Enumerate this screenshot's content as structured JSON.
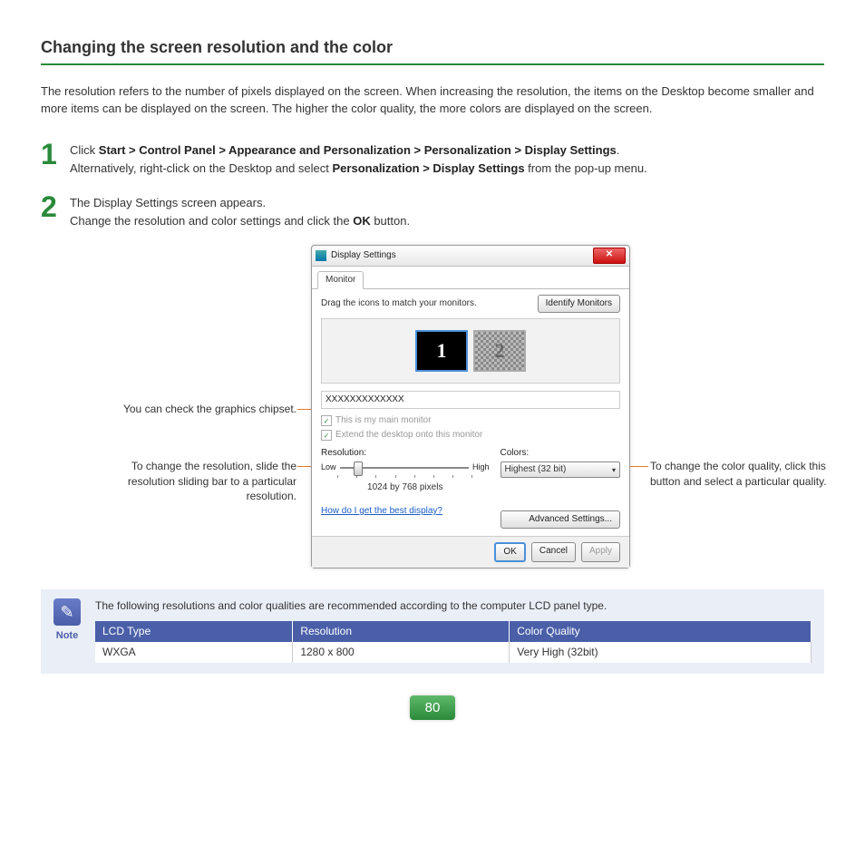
{
  "title": "Changing the screen resolution and the color",
  "intro": "The resolution refers to the number of pixels displayed on the screen. When increasing the resolution, the items on the Desktop become smaller and more items can be displayed on the screen. The higher the color quality, the more colors are displayed on the screen.",
  "step1": {
    "click": "Click ",
    "path": "Start > Control Panel > Appearance and Personalization > Personalization > Display Settings",
    "dot": ".",
    "alt_pre": "Alternatively, right-click on the Desktop and select ",
    "alt_bold": "Personalization > Display Settings",
    "alt_post": " from the pop-up menu."
  },
  "step2": {
    "a": "The Display Settings screen appears.",
    "b_pre": "Change the resolution and color settings and click the ",
    "b_bold": "OK",
    "b_post": " button."
  },
  "dialog": {
    "title": "Display Settings",
    "tab": "Monitor",
    "drag": "Drag the icons to match your monitors.",
    "identify": "Identify Monitors",
    "mon1": "1",
    "mon2": "2",
    "chipset": "XXXXXXXXXXXXX",
    "chk1": "This is my main monitor",
    "chk2": "Extend the desktop onto this monitor",
    "res_label": "Resolution:",
    "low": "Low",
    "high": "High",
    "pixels": "1024 by 768 pixels",
    "colors_label": "Colors:",
    "colors_value": "Highest (32 bit)",
    "link": "How do I get the best display?",
    "advanced": "Advanced Settings...",
    "ok": "OK",
    "cancel": "Cancel",
    "apply": "Apply"
  },
  "callouts": {
    "chipset": "You can check the graphics chipset.",
    "resolution": "To change the resolution, slide the resolution sliding bar to a particular resolution.",
    "colors": "To change the color quality, click this button and select a particular quality."
  },
  "note": {
    "label": "Note",
    "intro": "The following resolutions and color qualities are recommended according to the computer LCD panel type.",
    "headers": [
      "LCD Type",
      "Resolution",
      "Color Quality"
    ],
    "row": [
      "WXGA",
      "1280 x 800",
      "Very High (32bit)"
    ]
  },
  "page": "80"
}
